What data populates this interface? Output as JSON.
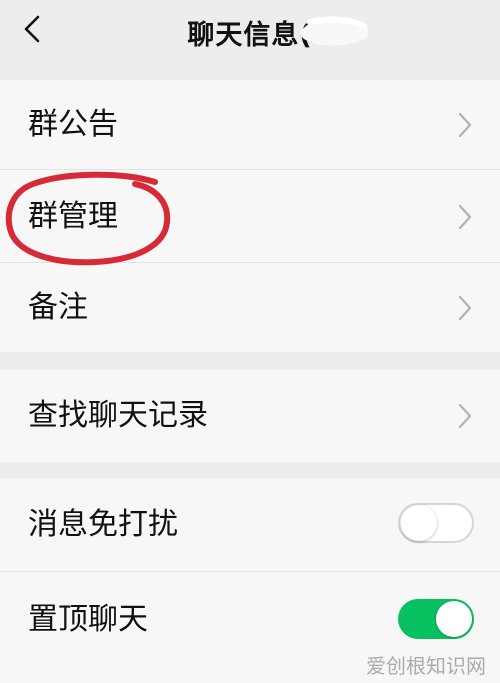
{
  "header": {
    "title": "聊天信息(",
    "back_icon": "chevron-left-icon"
  },
  "groups": [
    {
      "items": [
        {
          "label": "群公告",
          "type": "link"
        },
        {
          "label": "群管理",
          "type": "link",
          "highlighted": true
        },
        {
          "label": "备注",
          "type": "link"
        }
      ]
    },
    {
      "items": [
        {
          "label": "查找聊天记录",
          "type": "link"
        }
      ]
    },
    {
      "items": [
        {
          "label": "消息免打扰",
          "type": "toggle",
          "on": false
        },
        {
          "label": "置顶聊天",
          "type": "toggle",
          "on": true
        }
      ]
    }
  ],
  "colors": {
    "toggle_on": "#07c160",
    "highlight_circle": "#d62a36",
    "background": "#ededed",
    "row_bg": "#f7f7f7"
  },
  "watermark": "爱创根知识网"
}
